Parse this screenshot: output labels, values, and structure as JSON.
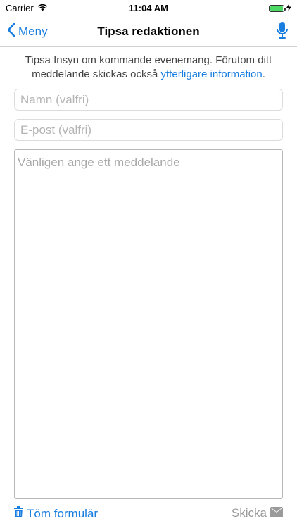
{
  "status_bar": {
    "carrier": "Carrier",
    "time": "11:04 AM",
    "battery_level": 1.0
  },
  "navbar": {
    "back_label": "Meny",
    "title": "Tipsa redaktionen",
    "mic_icon": "microphone-icon"
  },
  "intro": {
    "text": "Tipsa Insyn om kommande evenemang. Förutom ditt meddelande skickas också",
    "link": "ytterligare information",
    "end": "."
  },
  "form": {
    "name_placeholder": "Namn (valfri)",
    "email_placeholder": "E-post (valfri)",
    "message_placeholder": "Vänligen ange ett meddelande"
  },
  "actions": {
    "clear_label": "Töm formulär",
    "send_label": "Skicka"
  },
  "colors": {
    "accent": "#1a7ee0",
    "disabled": "#9a9a9a"
  }
}
